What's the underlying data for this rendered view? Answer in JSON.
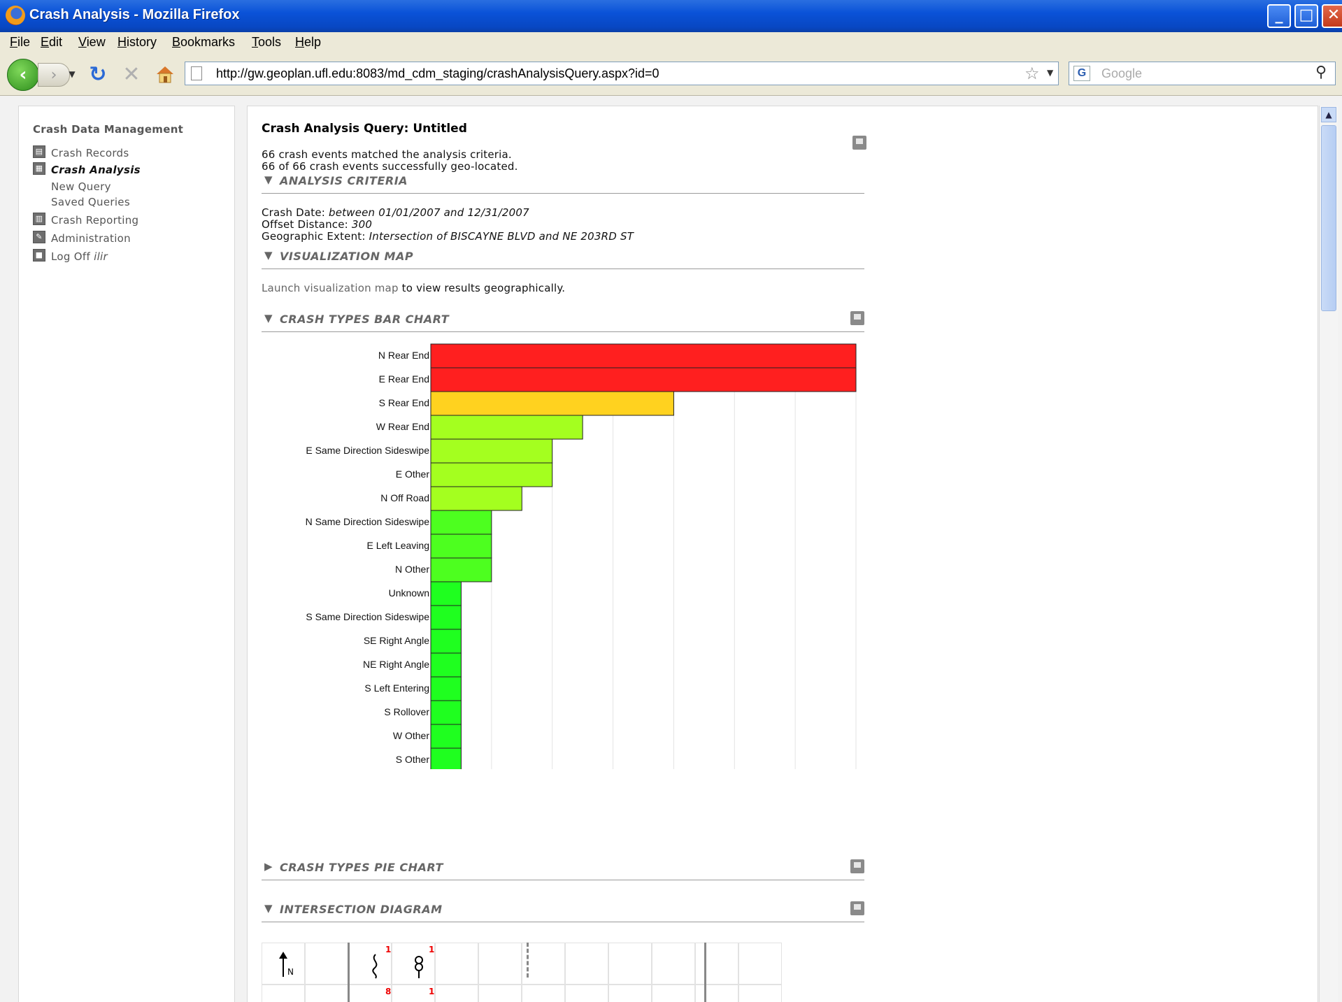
{
  "window": {
    "title": "Crash Analysis - Mozilla Firefox"
  },
  "menu": [
    "File",
    "Edit",
    "View",
    "History",
    "Bookmarks",
    "Tools",
    "Help"
  ],
  "address": {
    "url": "http://gw.geoplan.ufl.edu:8083/md_cdm_staging/crashAnalysisQuery.aspx?id=0"
  },
  "search": {
    "placeholder": "Google"
  },
  "sidebar": {
    "heading": "Crash Data Management",
    "items": [
      {
        "label": "Crash Records",
        "icon": "document-icon"
      },
      {
        "label": "Crash Analysis",
        "icon": "table-icon",
        "active": true
      },
      {
        "label": "New Query"
      },
      {
        "label": "Saved Queries"
      },
      {
        "label": "Crash Reporting",
        "icon": "bar-chart-icon"
      },
      {
        "label": "Administration",
        "icon": "wrench-icon"
      },
      {
        "label": "Log Off",
        "suffix": "ilir",
        "icon": "logoff-icon"
      }
    ]
  },
  "main": {
    "title": "Crash Analysis Query: Untitled",
    "summary1": "66 crash events matched the analysis criteria.",
    "summary2": "66 of 66 crash events successfully geo-located.",
    "sections": {
      "criteria": "ANALYSIS CRITERIA",
      "map": "VISUALIZATION MAP",
      "bar": "CRASH TYPES BAR CHART",
      "pie": "CRASH TYPES PIE CHART",
      "diagram": "INTERSECTION DIAGRAM"
    },
    "criteria": {
      "date_label": "Crash Date:",
      "date_value": "between 01/01/2007 and 12/31/2007",
      "offset_label": "Offset Distance:",
      "offset_value": "300",
      "extent_label": "Geographic Extent:",
      "extent_value": "Intersection of BISCAYNE BLVD and NE 203RD ST"
    },
    "map": {
      "link": "Launch visualization map",
      "rest": "to view results geographically."
    },
    "diagram": {
      "north": "N",
      "badges": [
        "1",
        "1",
        "8",
        "1"
      ]
    }
  },
  "chart_data": {
    "type": "bar",
    "orientation": "horizontal",
    "categories": [
      "N Rear End",
      "E Rear End",
      "S Rear End",
      "W Rear End",
      "E Same Direction Sideswipe",
      "E Other",
      "N Off Road",
      "N Same Direction Sideswipe",
      "E Left Leaving",
      "N Other",
      "Unknown",
      "S Same Direction Sideswipe",
      "SE Right Angle",
      "NE Right Angle",
      "S Left Entering",
      "S Rollover",
      "W Other",
      "S Other"
    ],
    "values": [
      14,
      14,
      8,
      5,
      4,
      4,
      3,
      2,
      2,
      2,
      1,
      1,
      1,
      1,
      1,
      1,
      1,
      1
    ],
    "xlim": [
      0,
      14
    ],
    "xticks": [
      2,
      4,
      6,
      8,
      10,
      12,
      14
    ],
    "colors": [
      "#ff1f1f",
      "#ff1f1f",
      "#ffd21f",
      "#a4ff1f",
      "#a4ff1f",
      "#a4ff1f",
      "#a4ff1f",
      "#4dff1f",
      "#4dff1f",
      "#4dff1f",
      "#1fff1f",
      "#1fff1f",
      "#1fff1f",
      "#1fff1f",
      "#1fff1f",
      "#1fff1f",
      "#1fff1f",
      "#1fff1f"
    ],
    "grid": true
  }
}
